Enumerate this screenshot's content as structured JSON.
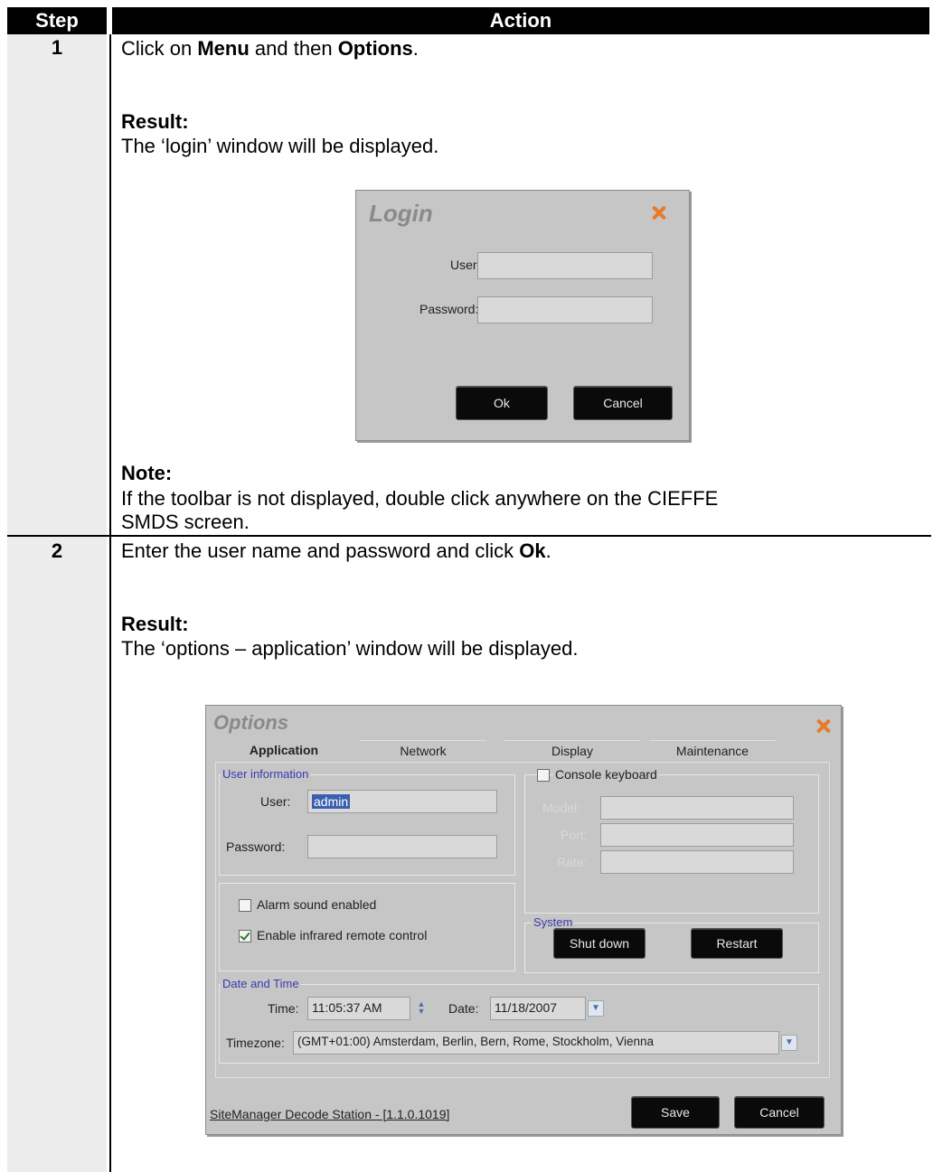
{
  "table": {
    "header": {
      "step": "Step",
      "action": "Action"
    }
  },
  "step1": {
    "number": "1",
    "line1": {
      "pre": "Click on ",
      "b1": "Menu",
      "mid": " and then ",
      "b2": "Options",
      "post": "."
    },
    "result_label": "Result:",
    "result_text": "The ‘login’ window will be displayed.",
    "note_label": "Note:",
    "note_line1": "If the toolbar is not displayed, double click anywhere on the CIEFFE",
    "note_line2": "SMDS screen."
  },
  "login": {
    "title": "Login",
    "user_label": "User:",
    "user_value": "",
    "password_label": "Password:",
    "password_value": "",
    "ok_label": "Ok",
    "cancel_label": "Cancel"
  },
  "step2": {
    "number": "2",
    "line1": {
      "pre": "Enter the user name and password and click ",
      "b1": "Ok",
      "post": "."
    },
    "result_label": "Result:",
    "result_text": "The ‘options – application’ window will be displayed."
  },
  "options": {
    "title": "Options",
    "tabs": [
      "Application",
      "Network",
      "Display",
      "Maintenance"
    ],
    "user_info_title": "User information",
    "user_label": "User:",
    "user_value": "admin",
    "password_label": "Password:",
    "password_value": "",
    "console_keyboard_label": "Console keyboard",
    "console_keyboard_checked": false,
    "model_label": "Model:",
    "port_label": "Port:",
    "rate_label": "Rate:",
    "alarm_sound_label": "Alarm sound enabled",
    "alarm_sound_checked": false,
    "infrared_label": "Enable infrared remote control",
    "infrared_checked": true,
    "system_title": "System",
    "shutdown_label": "Shut down",
    "restart_label": "Restart",
    "datetime_title": "Date and Time",
    "time_label": "Time:",
    "time_value": "11:05:37 AM",
    "date_label": "Date:",
    "date_value": "11/18/2007",
    "timezone_label": "Timezone:",
    "timezone_value": "(GMT+01:00) Amsterdam, Berlin, Bern, Rome, Stockholm, Vienna",
    "version_text": "SiteManager Decode Station - [1.1.0.1019]",
    "save_label": "Save",
    "cancel_label": "Cancel"
  }
}
